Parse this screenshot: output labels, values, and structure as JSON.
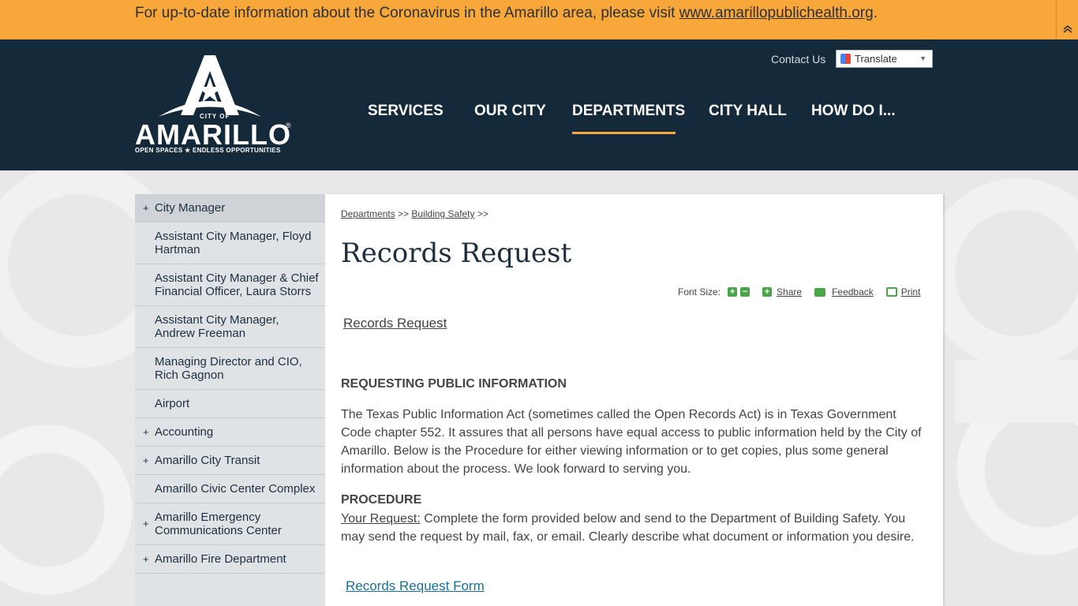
{
  "alert": {
    "text": "For up-to-date information about the Coronavirus in the Amarillo area, please visit ",
    "link": "www.amarillopublichealth.org",
    "suffix": "."
  },
  "header": {
    "logo": {
      "city_of": "CITY OF",
      "name": "AMARILLO",
      "tagline": "OPEN SPACES ★ ENDLESS OPPORTUNITIES"
    },
    "contact_label": "Contact Us",
    "translate_label": "Translate",
    "nav": [
      {
        "label": "SERVICES",
        "active": false
      },
      {
        "label": "OUR CITY",
        "active": false
      },
      {
        "label": "DEPARTMENTS",
        "active": true
      },
      {
        "label": "CITY HALL",
        "active": false
      },
      {
        "label": "HOW DO I...",
        "active": false
      }
    ],
    "accent_color": "#f8a83a",
    "header_color": "#14293a"
  },
  "sidebar": {
    "items": [
      {
        "label": "City Manager",
        "expandable": true
      },
      {
        "label": "Assistant City Manager, Floyd Hartman",
        "expandable": false
      },
      {
        "label": "Assistant City Manager & Chief Financial Officer, Laura Storrs",
        "expandable": false
      },
      {
        "label": "Assistant City Manager, Andrew Freeman",
        "expandable": false
      },
      {
        "label": "Managing Director and CIO, Rich Gagnon",
        "expandable": false
      },
      {
        "label": "Airport",
        "expandable": false
      },
      {
        "label": "Accounting",
        "expandable": true
      },
      {
        "label": "Amarillo City Transit",
        "expandable": true
      },
      {
        "label": "Amarillo Civic Center Complex",
        "expandable": false
      },
      {
        "label": "Amarillo Emergency Communications Center",
        "expandable": true
      },
      {
        "label": "Amarillo Fire Department",
        "expandable": true
      }
    ]
  },
  "content": {
    "breadcrumb": {
      "item1": "Departments",
      "item2": "Building Safety",
      "sep": ">>"
    },
    "title": "Records Request",
    "tools": {
      "font_size_label": "Font Size:",
      "share_label": "Share",
      "feedback_label": "Feedback",
      "print_label": "Print"
    },
    "top_link": "Records Request",
    "heading1": "REQUESTING PUBLIC INFORMATION",
    "para1": "The Texas Public Information Act (sometimes called the Open Records Act) is in Texas Government Code chapter 552. It assures that all persons have equal access to public information held by the City of Amarillo. Below is the Procedure for either viewing information or to get copies, plus some general information about the process.  We look forward to serving you.",
    "heading2": "PROCEDURE",
    "para2_label": "Your Request:",
    "para2": " Complete the form provided below and send to the Department of Building Safety. You may send the request by mail, fax, or email. Clearly describe what document or information you desire.",
    "form_link": "Records Request Form"
  }
}
